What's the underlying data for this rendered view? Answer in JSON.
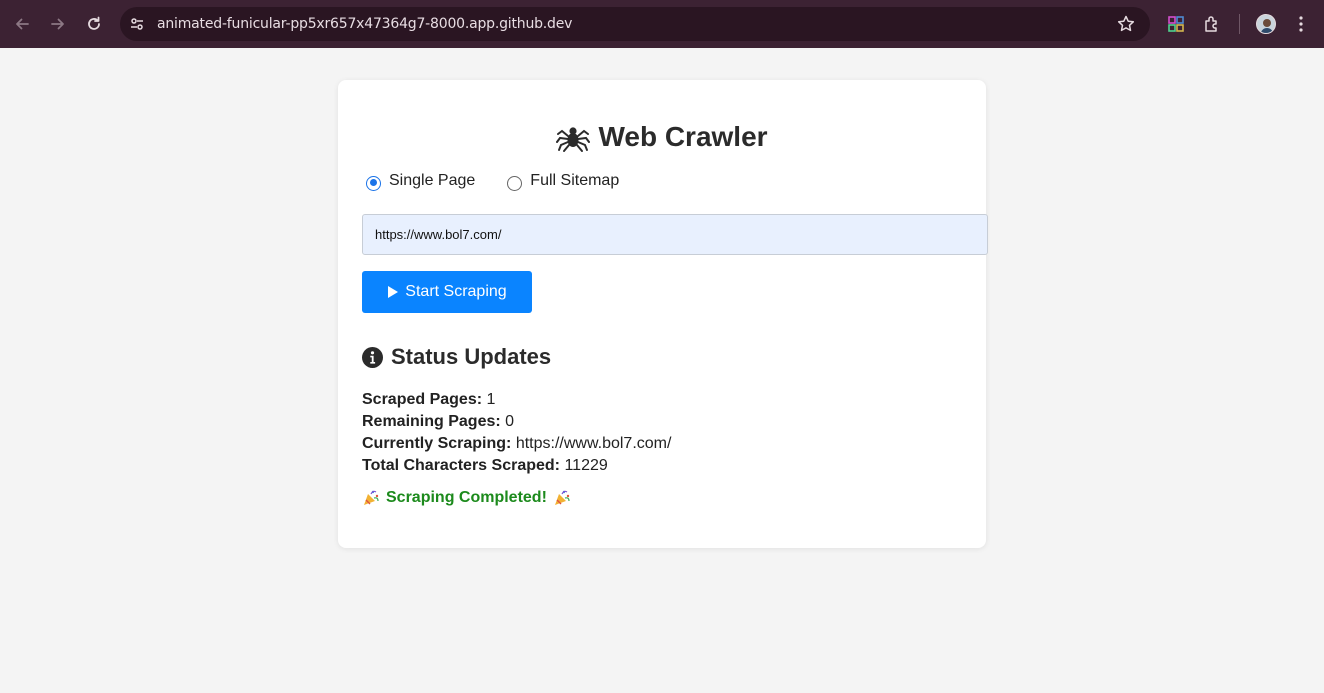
{
  "browser": {
    "url": "animated-funicular-pp5xr657x47364g7-8000.app.github.dev",
    "icons": [
      "back-arrow-icon",
      "forward-arrow-icon",
      "reload-icon",
      "site-info-icon",
      "bookmark-star-icon",
      "color-picker-icon",
      "extensions-icon",
      "profile-avatar",
      "more-menu-icon"
    ]
  },
  "app": {
    "title": "Web Crawler",
    "title_icon": "spider-icon",
    "mode_options": [
      {
        "label": "Single Page",
        "selected": true
      },
      {
        "label": "Full Sitemap",
        "selected": false
      }
    ],
    "url_value": "https://www.bol7.com/",
    "start_button": "Start Scraping",
    "status_title": "Status Updates",
    "stats": {
      "scraped_label": "Scraped Pages:",
      "scraped_value": "1",
      "remaining_label": "Remaining Pages:",
      "remaining_value": "0",
      "current_label": "Currently Scraping:",
      "current_value": "https://www.bol7.com/",
      "chars_label": "Total Characters Scraped:",
      "chars_value": "11229"
    },
    "completed_text": "Scraping Completed!"
  },
  "colors": {
    "accent": "#0a84ff",
    "success": "#1c8a1c",
    "chrome": "#3c2233"
  }
}
